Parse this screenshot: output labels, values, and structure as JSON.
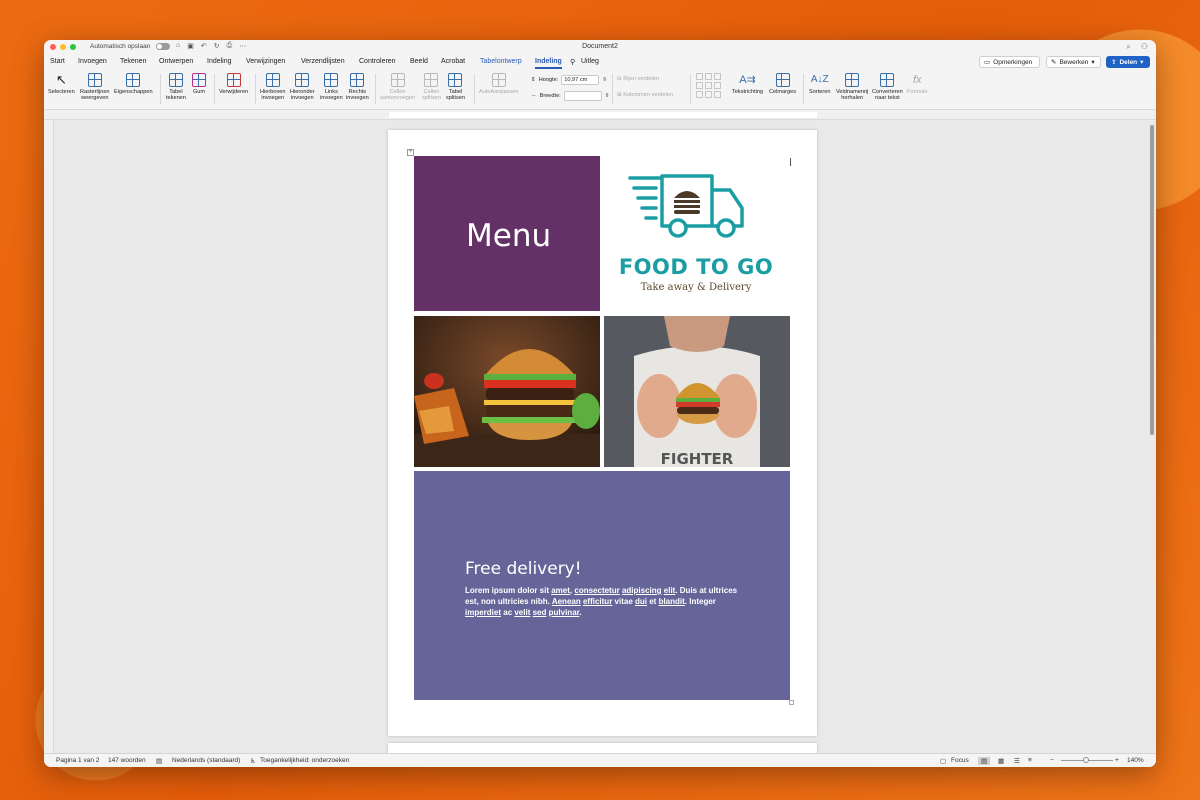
{
  "window": {
    "title": "Document2",
    "autosave_label": "Automatisch opslaan"
  },
  "tabs": [
    "Start",
    "Invoegen",
    "Tekenen",
    "Ontwerpen",
    "Indeling",
    "Verwijzingen",
    "Verzendlijsten",
    "Controleren",
    "Beeld",
    "Acrobat",
    "Tabelontwerp",
    "Indeling",
    "Uitleg"
  ],
  "top_buttons": {
    "comments": "Opmerkingen",
    "edit": "Bewerken",
    "share": "Delen"
  },
  "ribbon": {
    "select": "Selecteren",
    "gridlines_1": "Rasterlijnen",
    "gridlines_2": "weergeven",
    "properties": "Eigenschappen",
    "draw_table_1": "Tabel",
    "draw_table_2": "tekenen",
    "eraser": "Gum",
    "delete": "Verwijderen",
    "insert_above_1": "Hierboven",
    "insert_above_2": "invoegen",
    "insert_below_1": "Hieronder",
    "insert_below_2": "invoegen",
    "insert_left_1": "Links",
    "insert_left_2": "invoegen",
    "insert_right_1": "Rechts",
    "insert_right_2": "invoegen",
    "merge_cells_1": "Cellen",
    "merge_cells_2": "samenvoegen",
    "split_cells_1": "Cellen",
    "split_cells_2": "splitsen",
    "split_table_1": "Tabel",
    "split_table_2": "splitsen",
    "autofit": "AutoAanpassen",
    "height_label": "Hoogte:",
    "height_value": "10,97 cm",
    "width_label": "Breedte:",
    "width_value": "",
    "distribute_rows": "Rijen verdelen",
    "distribute_cols": "Kolommen verdelen",
    "text_direction": "Tekstrichting",
    "cell_margins": "Celmarges",
    "sort": "Sorteren",
    "repeat_header_1": "Veldnamenrij",
    "repeat_header_2": "herhalen",
    "convert_1": "Converteren",
    "convert_2": "naar tekst",
    "formula": "Formule"
  },
  "document": {
    "menu_title": "Menu",
    "logo_name": "FOOD TO GO",
    "logo_tagline": "Take away & Delivery",
    "delivery_title": "Free delivery!",
    "body": {
      "p1": "Lorem ipsum dolor sit ",
      "w_amet": "amet",
      "p2": ", ",
      "w_consectetur": "consectetur",
      "p3": " ",
      "w_adipiscing": "adipiscing",
      "p4": " ",
      "w_elit": "elit",
      "p5": ". Duis at ultrices est, non ultricies nibh. ",
      "w_aenean": "Aenean",
      "p6": " ",
      "w_efficitur": "efficitur",
      "p7": " vitae ",
      "w_dui": "dui",
      "p8": " et ",
      "w_blandit": "blandit",
      "p9": ". Integer ",
      "w_imperdiet": "imperdiet",
      "p10": " ac ",
      "w_velit": "velit",
      "p11": " ",
      "w_sed": "sed",
      "p12": " ",
      "w_pulvinar": "pulvinar",
      "p13": "."
    },
    "photo_shirt_text": "FIGHTER"
  },
  "status": {
    "page": "Pagina 1 van 2",
    "words": "147 woorden",
    "language": "Nederlands (standaard)",
    "accessibility": "Toegankelijkheid: onderzoeken",
    "focus": "Focus",
    "zoom": "140%"
  },
  "colors": {
    "menu_cell": "#643167",
    "delivery_cell": "#66659a",
    "logo_teal": "#1a9ea3",
    "accent_blue": "#1f63c6",
    "background": "#e8650f"
  }
}
